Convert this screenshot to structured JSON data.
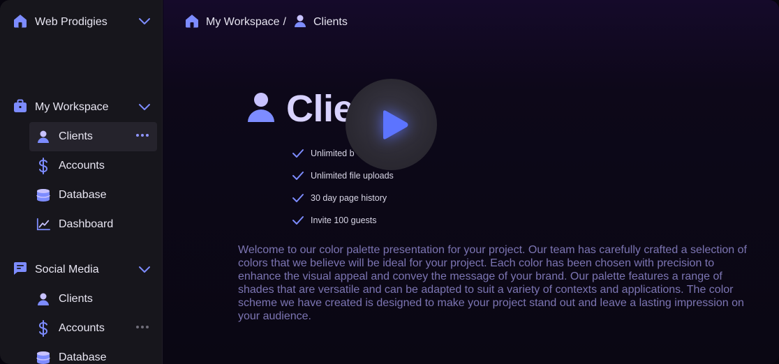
{
  "colors": {
    "accent": "#7d8cff",
    "sidebar_bg": "#17161c",
    "active_item_bg": "#25232c",
    "title_color": "#d8d2ff",
    "description_color": "#7c75b3"
  },
  "sidebar": {
    "workspace_switcher": {
      "label": "Web Prodigies",
      "icon": "home-icon"
    },
    "groups": [
      {
        "label": "My Workspace",
        "icon": "briefcase-icon",
        "items": [
          {
            "label": "Clients",
            "icon": "user-icon",
            "active": true
          },
          {
            "label": "Accounts",
            "icon": "dollar-icon"
          },
          {
            "label": "Database",
            "icon": "database-icon"
          },
          {
            "label": "Dashboard",
            "icon": "chart-icon"
          }
        ]
      },
      {
        "label": "Social Media",
        "icon": "chat-icon",
        "items": [
          {
            "label": "Clients",
            "icon": "user-icon"
          },
          {
            "label": "Accounts",
            "icon": "dollar-icon"
          },
          {
            "label": "Database",
            "icon": "database-icon"
          }
        ]
      }
    ]
  },
  "breadcrumb": {
    "workspace": "My Workspace",
    "separator": "/",
    "page": "Clients"
  },
  "main": {
    "title": "Clie",
    "features": [
      "Unlimited b",
      "Unlimited file uploads",
      "30 day page history",
      "Invite 100 guests"
    ],
    "description": "Welcome to our color palette presentation for your project. Our team has carefully crafted a selection of colors that we believe will be ideal for your project. Each color has been chosen with precision to enhance the visual appeal and convey the message of your brand. Our palette features a range of shades that are versatile and can be adapted to suit a variety of contexts and applications. The color scheme we have created is designed to make your project stand out and leave a lasting impression on your audience."
  }
}
